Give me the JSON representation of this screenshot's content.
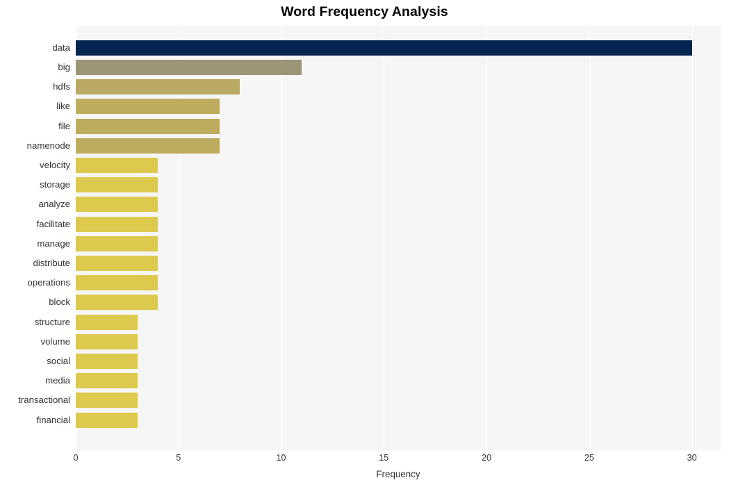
{
  "chart_data": {
    "type": "bar",
    "orientation": "horizontal",
    "title": "Word Frequency Analysis",
    "xlabel": "Frequency",
    "ylabel": "",
    "xlim": [
      0,
      31.4
    ],
    "ylim": null,
    "grid": true,
    "legend": null,
    "xticks": [
      0,
      5,
      10,
      15,
      20,
      25,
      30
    ],
    "xtick_labels": [
      "0",
      "5",
      "10",
      "15",
      "20",
      "25",
      "30"
    ],
    "categories": [
      "data",
      "big",
      "hdfs",
      "like",
      "file",
      "namenode",
      "velocity",
      "storage",
      "analyze",
      "facilitate",
      "manage",
      "distribute",
      "operations",
      "block",
      "structure",
      "volume",
      "social",
      "media",
      "transactional",
      "financial"
    ],
    "values": [
      30,
      11,
      8,
      7,
      7,
      7,
      4,
      4,
      4,
      4,
      4,
      4,
      4,
      4,
      3,
      3,
      3,
      3,
      3,
      3
    ],
    "bar_colors": [
      "#05244f",
      "#9b9477",
      "#b9a963",
      "#bdac5e",
      "#bdac5e",
      "#bdac5e",
      "#ddc94e",
      "#ddc94e",
      "#ddc94e",
      "#ddc94e",
      "#ddc94e",
      "#ddc94e",
      "#ddc94e",
      "#ddc94e",
      "#ddc94e",
      "#ddc94e",
      "#ddc94e",
      "#ddc94e",
      "#ddc94e",
      "#ddc94e"
    ]
  },
  "style": {
    "figure_background": "#ffffff",
    "plot_background": "#f6f6f6",
    "grid_color": "#ffffff",
    "title_color": "#000000",
    "tick_color": "#333333"
  }
}
